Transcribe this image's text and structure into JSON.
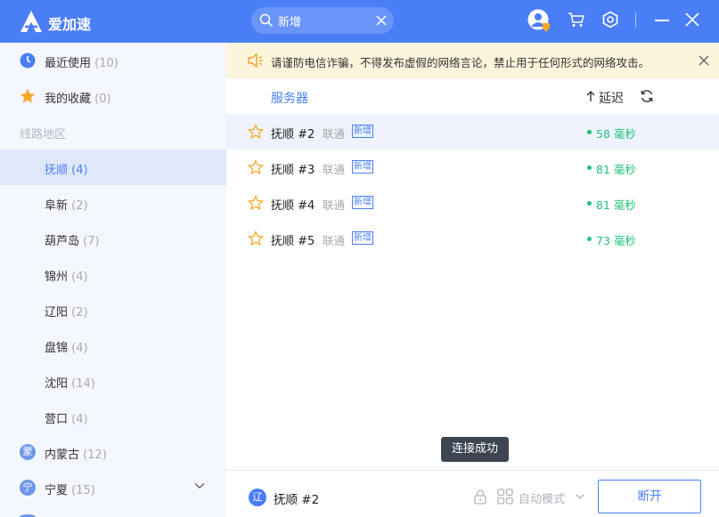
{
  "app": {
    "name": "爱加速"
  },
  "search": {
    "value": "新增"
  },
  "sidebar": {
    "recent": {
      "label": "最近使用",
      "count": "(10)"
    },
    "favorites": {
      "label": "我的收藏",
      "count": "(0)"
    },
    "section_title": "线路地区",
    "regions": [
      {
        "label": "抚顺",
        "count": "(4)"
      },
      {
        "label": "阜新",
        "count": "(2)"
      },
      {
        "label": "葫芦岛",
        "count": "(7)"
      },
      {
        "label": "锦州",
        "count": "(4)"
      },
      {
        "label": "辽阳",
        "count": "(2)"
      },
      {
        "label": "盘锦",
        "count": "(4)"
      },
      {
        "label": "沈阳",
        "count": "(14)"
      },
      {
        "label": "营口",
        "count": "(4)"
      }
    ],
    "provinces": [
      {
        "badge": "蒙",
        "label": "内蒙古",
        "count": "(12)"
      },
      {
        "badge": "宁",
        "label": "宁夏",
        "count": "(15)"
      }
    ]
  },
  "notice": {
    "text": "请谨防电信诈骗，不得发布虚假的网络言论，禁止用于任何形式的网络攻击。"
  },
  "table": {
    "col_server": "服务器",
    "col_latency": "延迟",
    "rows": [
      {
        "name": "抚顺 #2",
        "isp": "联通",
        "tag": "新增",
        "latency": "58 毫秒"
      },
      {
        "name": "抚顺 #3",
        "isp": "联通",
        "tag": "新增",
        "latency": "81 毫秒"
      },
      {
        "name": "抚顺 #4",
        "isp": "联通",
        "tag": "新增",
        "latency": "81 毫秒"
      },
      {
        "name": "抚顺 #5",
        "isp": "联通",
        "tag": "新增",
        "latency": "73 毫秒"
      }
    ]
  },
  "toast": "连接成功",
  "bottom": {
    "region_badge": "辽",
    "server_name": "抚顺 #2",
    "mode": "自动模式",
    "disconnect": "断开"
  },
  "colors": {
    "brand": "#4a7ef7",
    "latency_good": "#22c07a",
    "favorite": "#f5a623"
  }
}
